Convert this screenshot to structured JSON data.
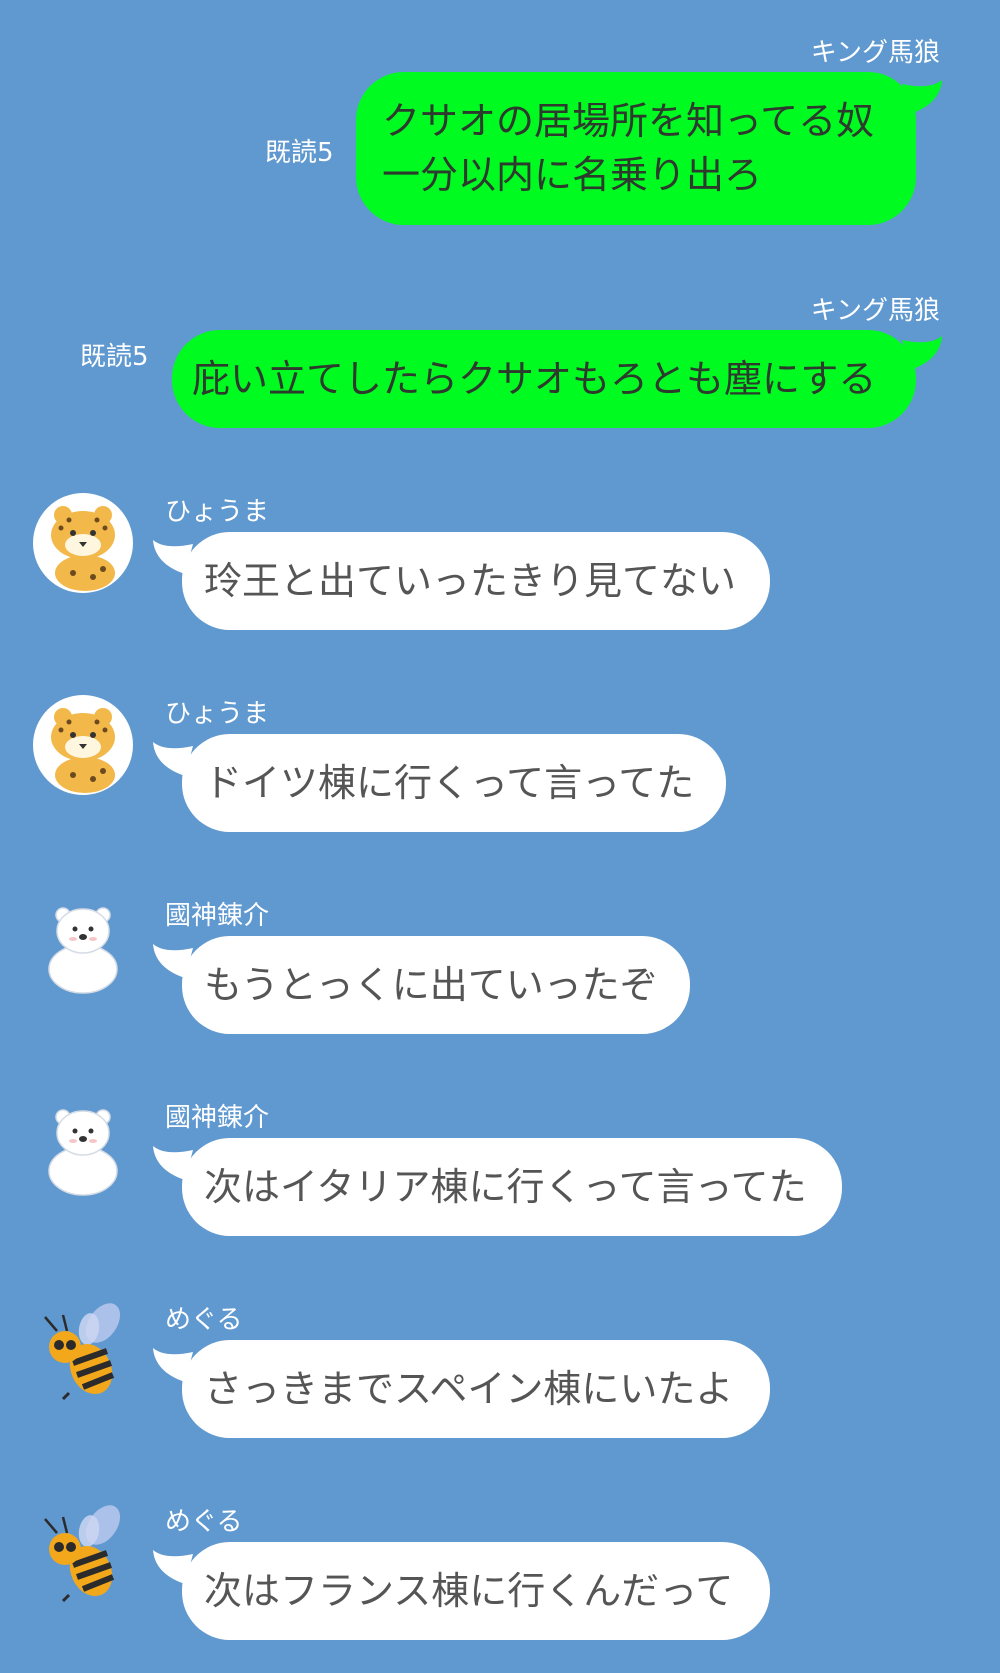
{
  "chat": {
    "messages": [
      {
        "sender": "キング馬狼",
        "read": "既読5",
        "text": "クサオの居場所を知ってる奴\n一分以内に名乗り出ろ"
      },
      {
        "sender": "キング馬狼",
        "read": "既読5",
        "text": "庇い立てしたらクサオもろとも塵にする"
      },
      {
        "sender": "ひょうま",
        "avatar": "leopard-icon",
        "text": "玲王と出ていったきり見てない"
      },
      {
        "sender": "ひょうま",
        "avatar": "leopard-icon",
        "text": "ドイツ棟に行くって言ってた"
      },
      {
        "sender": "國神錬介",
        "avatar": "polar-bear-icon",
        "text": "もうとっくに出ていったぞ"
      },
      {
        "sender": "國神錬介",
        "avatar": "polar-bear-icon",
        "text": "次はイタリア棟に行くって言ってた"
      },
      {
        "sender": "めぐる",
        "avatar": "bee-icon",
        "text": "さっきまでスペイン棟にいたよ"
      },
      {
        "sender": "めぐる",
        "avatar": "bee-icon",
        "text": "次はフランス棟に行くんだって"
      }
    ]
  },
  "colors": {
    "background": "#6099d0",
    "outgoing_bubble": "#00fb21",
    "incoming_bubble": "#ffffff"
  }
}
